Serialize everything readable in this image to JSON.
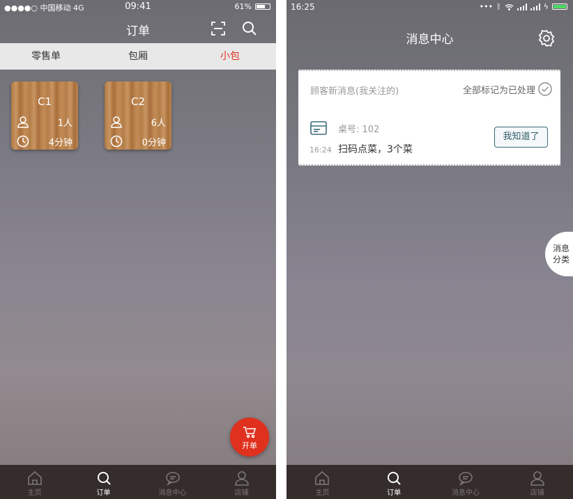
{
  "left": {
    "status": {
      "carrier": "●●●●○ 中国移动  4G",
      "time": "09:41",
      "battery": "61%"
    },
    "title": "订单",
    "segments": [
      {
        "label": "零售单",
        "active": false
      },
      {
        "label": "包厢",
        "active": false
      },
      {
        "label": "小包",
        "active": true
      }
    ],
    "rooms": [
      {
        "name": "C1",
        "people": "1人",
        "duration": "4分钟"
      },
      {
        "name": "C2",
        "people": "6人",
        "duration": "0分钟"
      }
    ],
    "fab_label": "开单"
  },
  "right": {
    "status": {
      "time": "16:25"
    },
    "title": "消息中心",
    "card": {
      "section_label": "顾客新消息(我关注的)",
      "mark_all": "全部标记为已处理",
      "table_no": "桌号: 102",
      "time": "16:24",
      "detail": "扫码点菜，3个菜",
      "ack_button": "我知道了"
    },
    "side_tab": [
      "消息",
      "分类"
    ]
  },
  "tabs": [
    {
      "label": "主页",
      "icon": "home-icon"
    },
    {
      "label": "订单",
      "icon": "search-icon"
    },
    {
      "label": "消息中心",
      "icon": "chat-icon"
    },
    {
      "label": "店铺",
      "icon": "person-icon"
    }
  ],
  "colors": {
    "accent": "#e0301e",
    "tabbar": "#352d2c",
    "ack_border": "#3b6b7a"
  }
}
